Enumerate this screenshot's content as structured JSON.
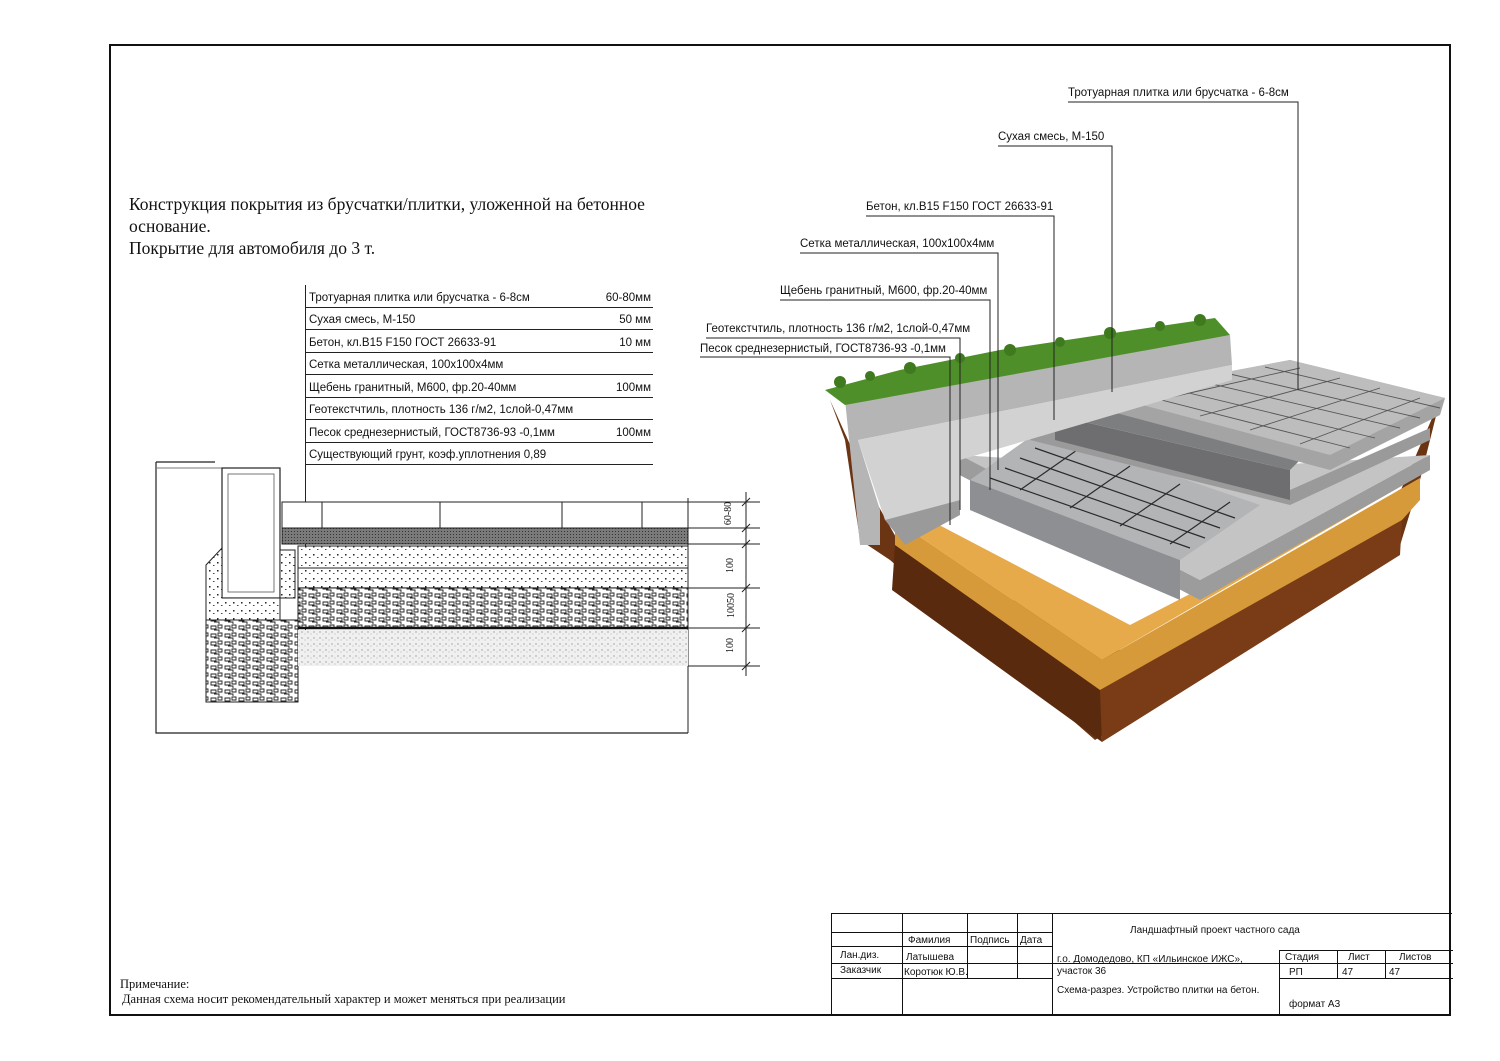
{
  "title": {
    "line1": "Конструкция покрытия из брусчатки/плитки, уложенной на бетонное",
    "line2": "основание.",
    "line3": "Покрытие для автомобиля до 3 т."
  },
  "layers": [
    {
      "name": "Тротуарная плитка  или брусчатка - 6-8см",
      "thickness": "60-80мм"
    },
    {
      "name": "Сухая смесь, М-150",
      "thickness": "50 мм"
    },
    {
      "name": "Бетон, кл.В15 F150 ГОСТ 26633-91",
      "thickness": "10 мм"
    },
    {
      "name": "Сетка металлическая, 100х100х4мм",
      "thickness": ""
    },
    {
      "name": "Щебень гранитный, М600, фр.20-40мм",
      "thickness": "100мм"
    },
    {
      "name": "Геотекстчтиль, плотность 136 г/м2, 1слой-0,47мм",
      "thickness": ""
    },
    {
      "name": "Песок среднезернистый, ГОСТ8736-93 -0,1мм",
      "thickness": "100мм"
    },
    {
      "name": "Существующий грунт, коэф.уплотнения 0,89",
      "thickness": ""
    }
  ],
  "dimensions": [
    "60-80",
    "100",
    "10050",
    "100"
  ],
  "callouts": [
    "Тротуарная плитка  или брусчатка - 6-8см",
    "Сухая смесь, М-150",
    "Бетон, кл.В15 F150 ГОСТ 26633-91",
    "Сетка металлическая, 100х100х4мм",
    "Щебень гранитный, М600, фр.20-40мм",
    "Геотекстчтиль, плотность 136 г/м2, 1слой-0,47мм",
    "Песок среднезернистый, ГОСТ8736-93 -0,1мм"
  ],
  "note": {
    "heading": "Примечание:",
    "text": "Данная схема носит рекомендательный характер и может меняться при реализации"
  },
  "stamp": {
    "project": "Ландшафтный проект частного сада",
    "col_surname": "Фамилия",
    "col_signature": "Подпись",
    "col_date": "Дата",
    "role1": "Лан.диз.",
    "person1": "Латышева",
    "role2": "Заказчик",
    "person2": "Коротюк Ю.В.",
    "address": "г.о. Домодедово, КП «Ильинское ИЖС»,",
    "plot": "участок 36",
    "stage_label": "Стадия",
    "sheet_label": "Лист",
    "sheets_label": "Листов",
    "stage": "РП",
    "sheet": "47",
    "sheets": "47",
    "drawing": "Схема-разрез. Устройство плитки на бетон.",
    "format": "формат А3"
  },
  "colors": {
    "grass": "#4f8f2a",
    "soil": "#6b3413",
    "sand": "#d79a3a",
    "gravel": "#bdbdbd",
    "concrete": "#8d8f92",
    "paving": "#9a9a9a",
    "curb": "#c9c9c9"
  }
}
